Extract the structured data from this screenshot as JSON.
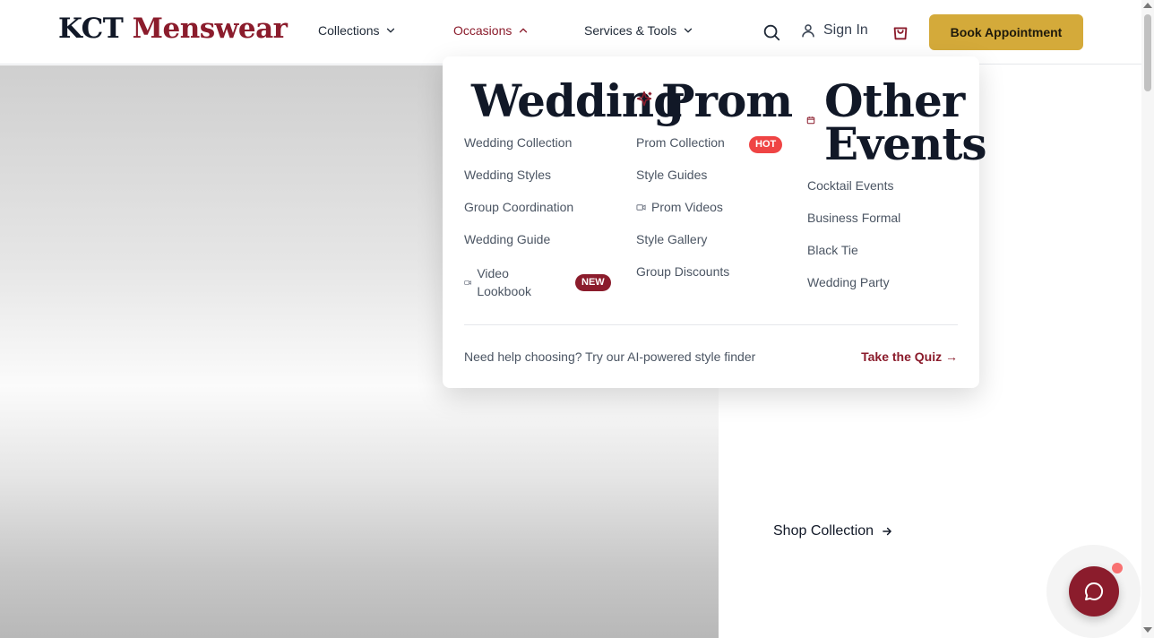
{
  "header": {
    "logo": {
      "part1": "KCT",
      "part2": "Menswear"
    },
    "nav": [
      {
        "label": "Collections",
        "icon": "chevron-down-icon"
      },
      {
        "label": "Occasions",
        "icon": "chevron-up-icon"
      },
      {
        "label": "Services & Tools",
        "icon": "chevron-down-icon"
      }
    ],
    "signin_label": "Sign In",
    "book_label": "Book Appointment"
  },
  "dropdown": {
    "columns": [
      {
        "heading": "Wedding",
        "icon": "sparkles-icon",
        "links": [
          {
            "label": "Wedding Collection"
          },
          {
            "label": "Wedding Styles"
          },
          {
            "label": "Group Coordination"
          },
          {
            "label": "Wedding Guide"
          },
          {
            "label": "Video Lookbook",
            "icon": "video-icon",
            "badge": "NEW"
          }
        ]
      },
      {
        "heading": "Prom",
        "links": [
          {
            "label": "Prom Collection",
            "badge": "HOT"
          },
          {
            "label": "Style Guides"
          },
          {
            "label": "Prom Videos",
            "icon": "video-icon"
          },
          {
            "label": "Style Gallery"
          },
          {
            "label": "Group Discounts"
          }
        ]
      },
      {
        "heading_line1": "Other",
        "heading_line2": "Events",
        "icon": "calendar-icon",
        "links": [
          {
            "label": "Cocktail Events"
          },
          {
            "label": "Business Formal"
          },
          {
            "label": "Black Tie"
          },
          {
            "label": "Wedding Party"
          }
        ]
      }
    ],
    "footer": {
      "help_text": "Need help choosing? Try our AI-powered style finder",
      "quiz_label": "Take the Quiz →"
    }
  },
  "hero": {
    "shop_label": "Shop Collection"
  },
  "colors": {
    "brand": "#8b1c2c",
    "gold": "#d4aa3a",
    "hot": "#ef4444"
  }
}
